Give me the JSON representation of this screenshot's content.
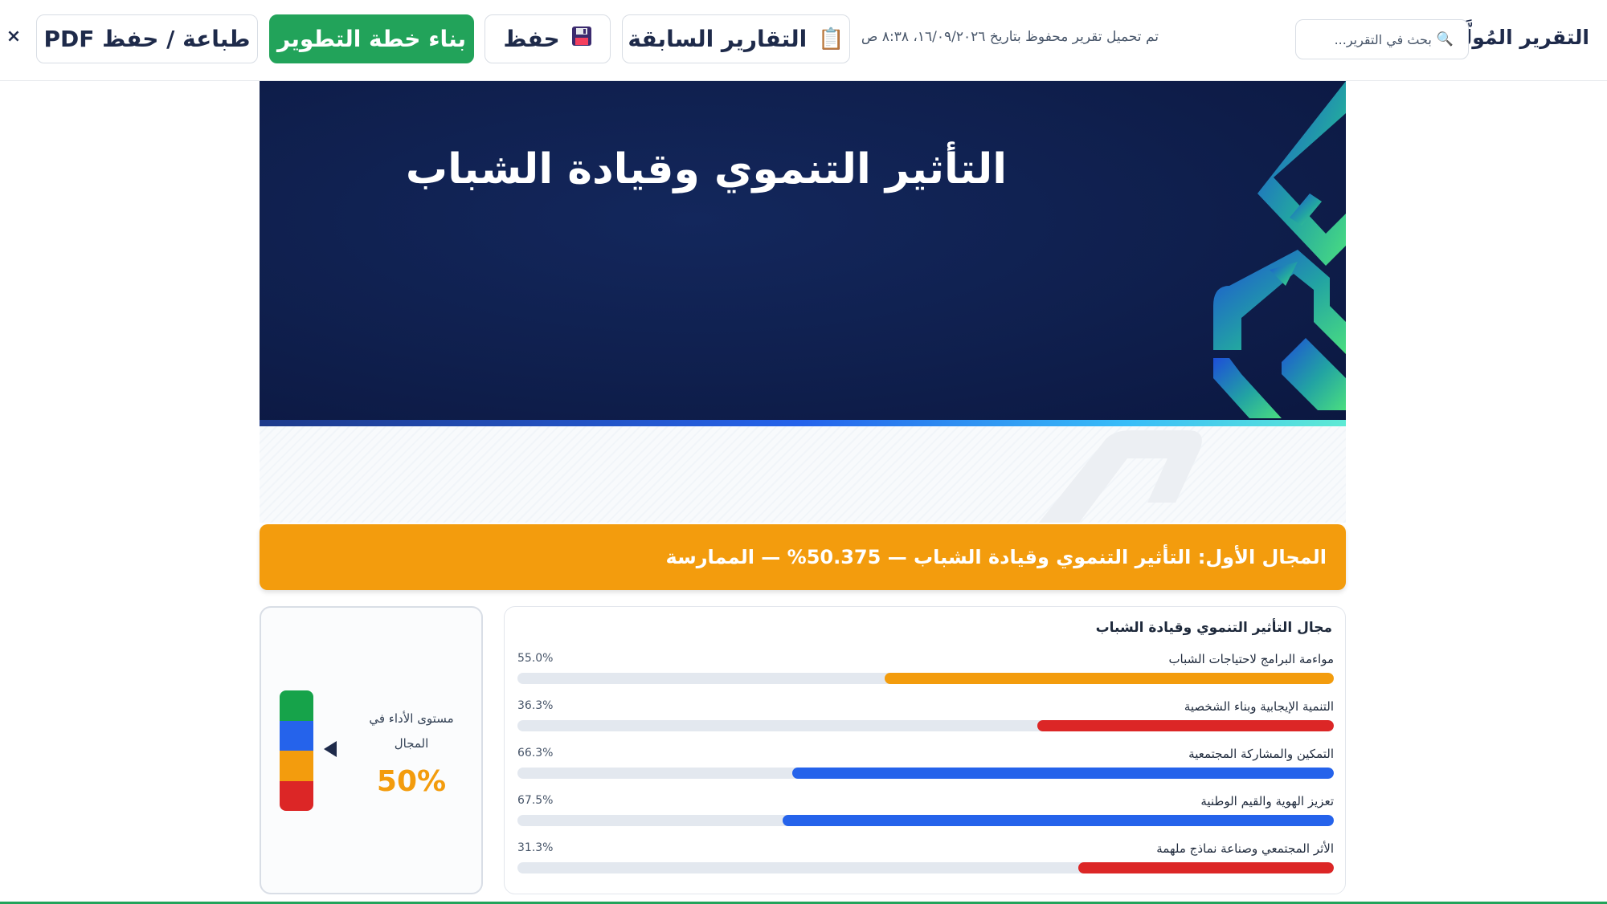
{
  "toolbar": {
    "title": "التقرير المُولَّد",
    "search_placeholder": "بحث في التقرير...",
    "search_icon": "search-icon",
    "status": "تم تحميل تقرير محفوظ بتاريخ ١٦/٠٩/٢٠٢٦، ٨:٣٨ ص",
    "previous_reports": "التقارير السابقة",
    "previous_reports_icon": "clipboard-icon",
    "save": "حفظ",
    "save_icon": "floppy-disk-icon",
    "build_plan": "بناء خطة التطوير",
    "print": "طباعة / حفظ PDF",
    "close": "×",
    "colors": {
      "primary_green": "#22a35a",
      "navy": "#1e2a4a"
    }
  },
  "cover": {
    "title": "التأثير التنموي وقيادة الشباب",
    "colors": {
      "background": "#0f1f4d",
      "logo_gradient_start": "#1d4ed8",
      "logo_gradient_end": "#4ade80"
    }
  },
  "domain_banner": {
    "text": "المجال الأول: التأثير التنموي وقيادة الشباب — 50.375% — الممارسة",
    "color": "#f39c0d"
  },
  "performance": {
    "label": "مستوى الأداء في المجال",
    "value": "50%",
    "value_color": "#f39c0d",
    "levels": [
      "#16a34a",
      "#2563eb",
      "#f39c0d",
      "#dc2626"
    ],
    "current_level_index": 2
  },
  "chart_data": {
    "type": "bar",
    "title": "مجال التأثير التنموي وقيادة الشباب",
    "orientation": "horizontal",
    "categories": [
      "مواءمة البرامج لاحتياجات الشباب",
      "التنمية الإيجابية وبناء الشخصية",
      "التمكين والمشاركة المجتمعية",
      "تعزيز الهوية والقيم الوطنية",
      "الأثر المجتمعي وصناعة نماذج ملهمة"
    ],
    "values": [
      55.0,
      36.3,
      66.3,
      67.5,
      31.3
    ],
    "value_labels": [
      "55.0%",
      "36.3%",
      "66.3%",
      "67.5%",
      "31.3%"
    ],
    "bar_colors": [
      "#f39c0d",
      "#dc2626",
      "#2563eb",
      "#2563eb",
      "#dc2626"
    ],
    "track_color": "#e3e8ef",
    "xlim": [
      0,
      100
    ]
  }
}
